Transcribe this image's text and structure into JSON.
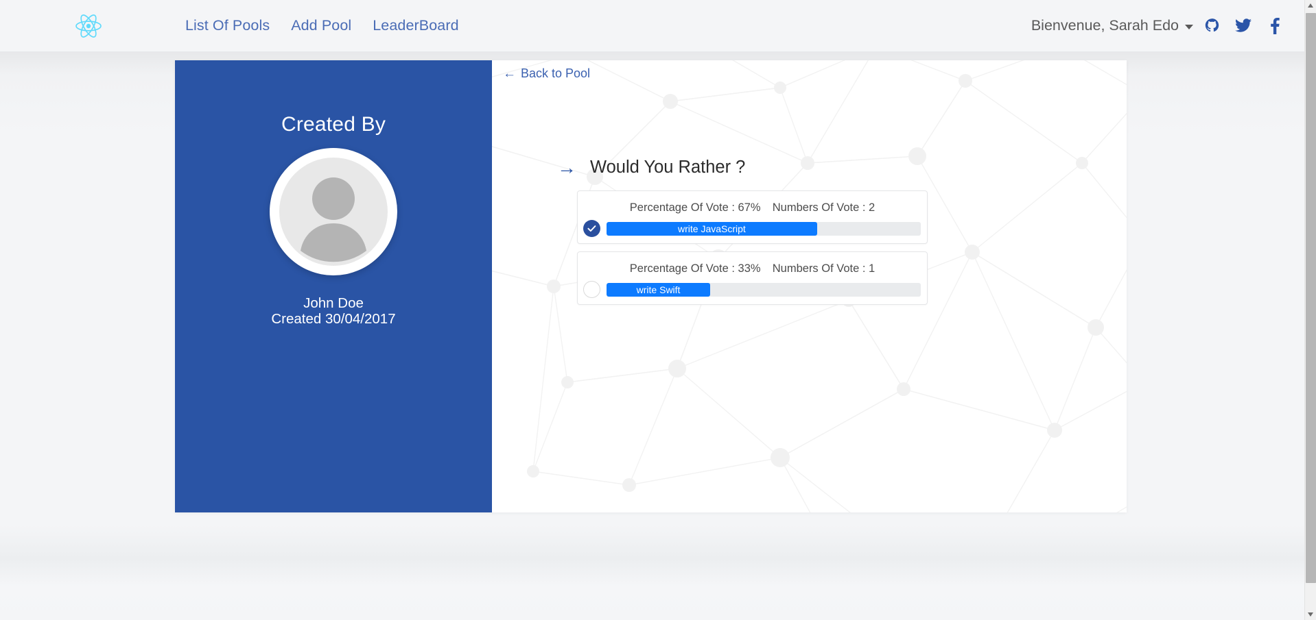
{
  "navbar": {
    "brand_icon": "react-logo-icon",
    "brand_color": "#61dafb",
    "links": [
      {
        "label": "List Of Pools",
        "name": "nav-link-list-of-pools"
      },
      {
        "label": "Add Pool",
        "name": "nav-link-add-pool"
      },
      {
        "label": "LeaderBoard",
        "name": "nav-link-leaderboard"
      }
    ],
    "user_greeting": "Bienvenue, Sarah Edo",
    "link_color": "#4a6cb5",
    "social": [
      {
        "name": "github-icon",
        "label": "GitHub"
      },
      {
        "name": "twitter-icon",
        "label": "Twitter"
      },
      {
        "name": "facebook-icon",
        "label": "Facebook"
      }
    ],
    "social_color": "#2b55a8"
  },
  "author_panel": {
    "title": "Created By",
    "avatar_alt": "default-user-avatar",
    "name": "John Doe",
    "created": "Created 30/04/2017",
    "background_color": "#2a54a5"
  },
  "poll": {
    "back_link": "Back to Pool",
    "back_arrow": "←",
    "question_arrow": "→",
    "question": "Would You Rather ?",
    "accent_color": "#0d7bff",
    "options": [
      {
        "text": "write JavaScript",
        "percentage_label": "Percentage Of Vote : 67%",
        "votes_label": "Numbers Of Vote : 2",
        "percent": 67,
        "votes": 2,
        "selected": true,
        "marker_icon": "check-circle-icon"
      },
      {
        "text": "write Swift",
        "percentage_label": "Percentage Of Vote : 33%",
        "votes_label": "Numbers Of Vote : 1",
        "percent": 33,
        "votes": 1,
        "selected": false,
        "marker_icon": "empty-circle-icon"
      }
    ]
  },
  "scrollbar": {
    "up_arrow": "scroll-up-arrow",
    "down_arrow": "scroll-down-arrow"
  }
}
